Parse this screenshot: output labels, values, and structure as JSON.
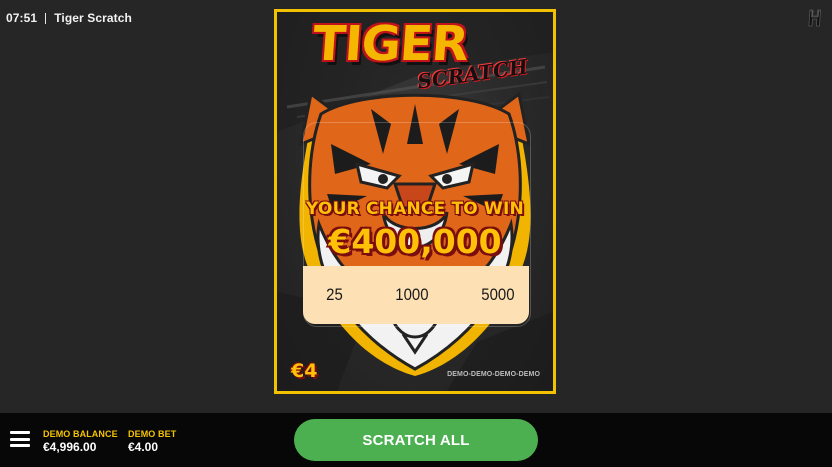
{
  "status": {
    "time": "07:51",
    "game_title": "Tiger Scratch"
  },
  "brand": {
    "icon": "h-logo-icon"
  },
  "card": {
    "logo_main": "TIGER",
    "logo_sub": "SCRATCH",
    "tagline": "YOUR CHANCE TO WIN",
    "top_prize": "€400,000",
    "numbers": [
      "25",
      "1000",
      "5000"
    ],
    "price": "€4",
    "watermark": "DEMO-DEMO-DEMO-DEMO",
    "artwork_icon": "tiger-face-icon"
  },
  "bottom_bar": {
    "balance_label": "DEMO BALANCE",
    "balance_value": "€4,996.00",
    "bet_label": "DEMO BET",
    "bet_value": "€4.00",
    "action_label": "SCRATCH ALL",
    "menu_icon": "hamburger-menu-icon"
  },
  "colors": {
    "background": "#262626",
    "card_border": "#f2c200",
    "accent_yellow": "#ffc107",
    "button_green": "#4caf50",
    "panel_peach": "#fde0b4",
    "bottom_bar": "#070707"
  }
}
